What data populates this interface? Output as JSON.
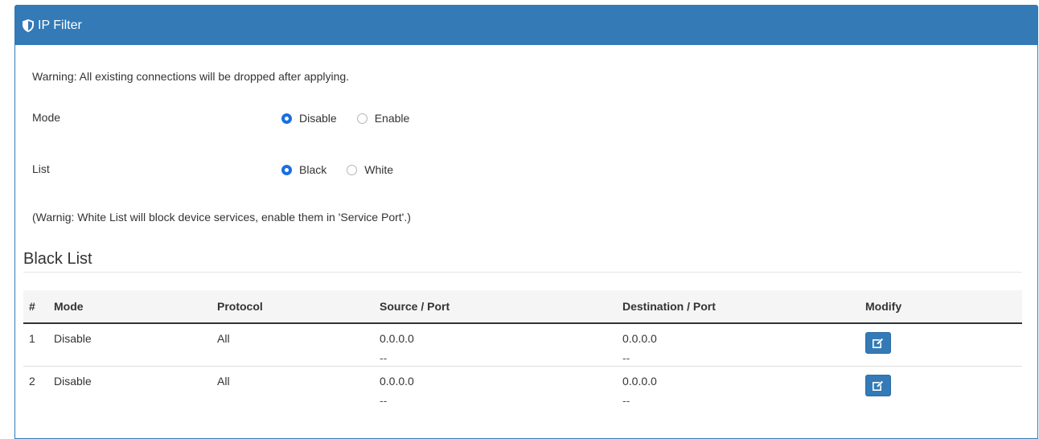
{
  "panel": {
    "title": "IP Filter",
    "icon": "shield-icon"
  },
  "warning": "Warning: All existing connections will be dropped after applying.",
  "mode": {
    "label": "Mode",
    "options": [
      {
        "label": "Disable",
        "selected": true
      },
      {
        "label": "Enable",
        "selected": false
      }
    ]
  },
  "list": {
    "label": "List",
    "options": [
      {
        "label": "Black",
        "selected": true
      },
      {
        "label": "White",
        "selected": false
      }
    ]
  },
  "note": "(Warnig: White List will block device services, enable them in 'Service Port'.)",
  "blacklist": {
    "title": "Black List",
    "columns": [
      "#",
      "Mode",
      "Protocol",
      "Source / Port",
      "Destination / Port",
      "Modify"
    ],
    "rows": [
      {
        "num": "1",
        "mode": "Disable",
        "protocol": "All",
        "source": "0.0.0.0",
        "source_port": "--",
        "dest": "0.0.0.0",
        "dest_port": "--"
      },
      {
        "num": "2",
        "mode": "Disable",
        "protocol": "All",
        "source": "0.0.0.0",
        "source_port": "--",
        "dest": "0.0.0.0",
        "dest_port": "--"
      }
    ]
  },
  "colors": {
    "accent": "#337ab7",
    "radio_checked": "#1a6fe0"
  }
}
